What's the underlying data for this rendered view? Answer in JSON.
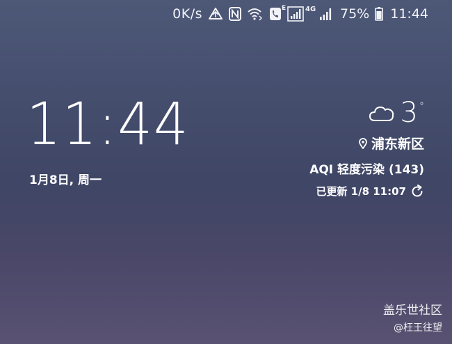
{
  "status_bar": {
    "net_speed": "0K/s",
    "signal1_tag": "E",
    "signal2_tag": "4G",
    "battery_percent": "75%",
    "time": "11:44",
    "icons": [
      "data-saver-icon",
      "nfc-icon",
      "wifi-call-icon",
      "phone-icon",
      "signal-icon",
      "signal-icon",
      "battery-icon"
    ]
  },
  "lockscreen": {
    "clock": "11:44",
    "date": "1月8日, 周一"
  },
  "weather": {
    "icon": "cloud-icon",
    "temperature": "3",
    "degree_symbol": "°",
    "location": "浦东新区",
    "aqi": "AQI 轻度污染 (143)",
    "updated": "已更新 1/8 11:07"
  },
  "watermark": {
    "title": "盖乐世社区",
    "user": "@枉王往望"
  },
  "colors": {
    "text": "#ffffff",
    "bg_top": "#4d5877",
    "bg_bottom": "#595272"
  }
}
